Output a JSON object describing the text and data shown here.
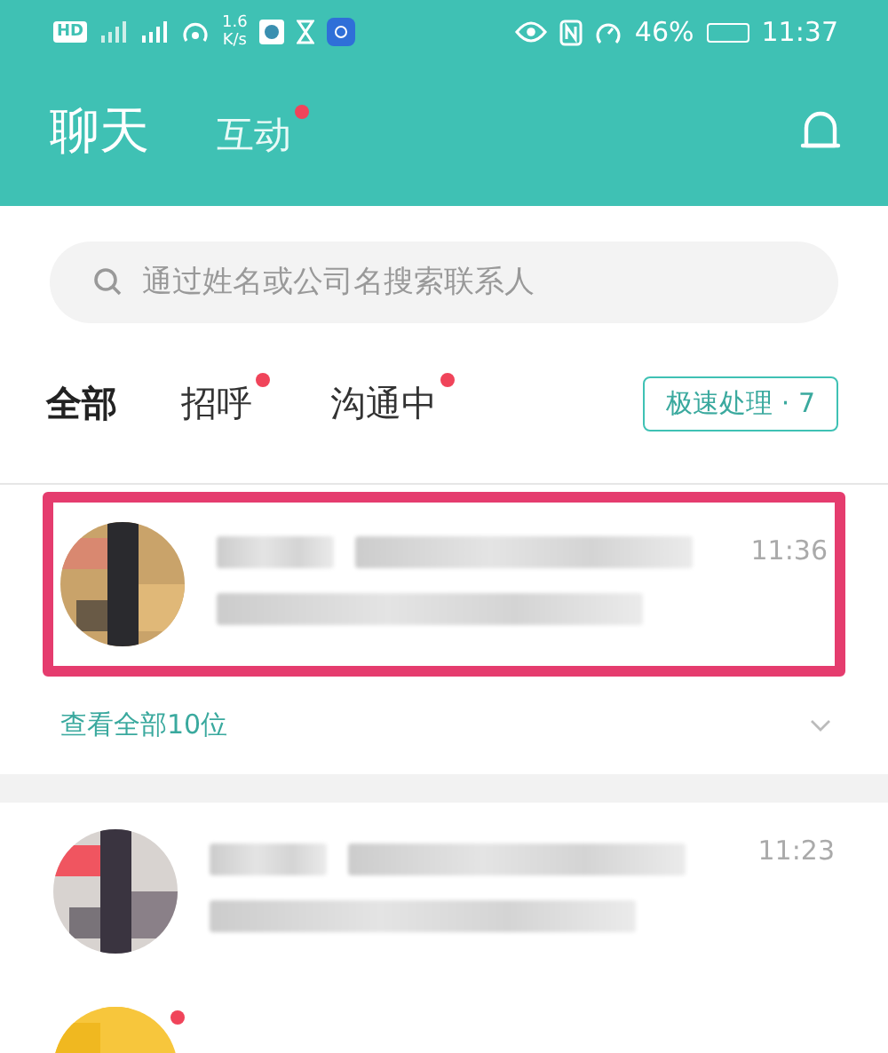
{
  "status_bar": {
    "hd": "HD",
    "speed": "1.6",
    "speed_unit": "K/s",
    "battery": "46%",
    "time": "11:37"
  },
  "header": {
    "tabs": [
      {
        "label": "聊天",
        "selected": true,
        "badge": false
      },
      {
        "label": "互动",
        "selected": false,
        "badge": true
      }
    ]
  },
  "search": {
    "placeholder": "通过姓名或公司名搜索联系人"
  },
  "filters": [
    {
      "label": "全部",
      "selected": true,
      "badge": false
    },
    {
      "label": "招呼",
      "selected": false,
      "badge": true
    },
    {
      "label": "沟通中",
      "selected": false,
      "badge": true
    }
  ],
  "quick_button": "极速处理 · 7",
  "groups": [
    {
      "rows": [
        {
          "time": "11:36",
          "highlighted": true,
          "unread": false
        }
      ],
      "view_all": "查看全部10位"
    },
    {
      "rows": [
        {
          "time": "11:23",
          "highlighted": false,
          "unread": false
        },
        {
          "highlighted": false,
          "unread": true
        }
      ]
    }
  ]
}
